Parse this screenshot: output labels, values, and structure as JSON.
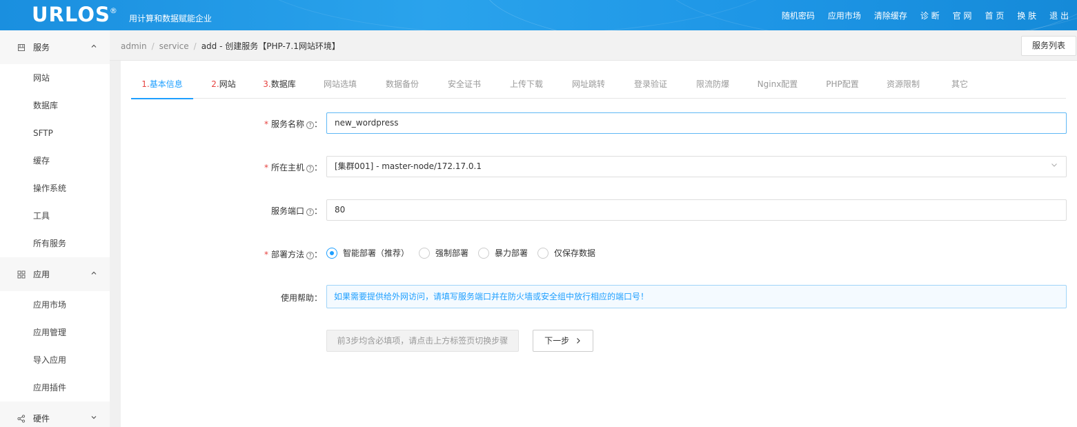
{
  "header": {
    "logo": "URLOS",
    "logo_mark": "®",
    "slogan": "用计算和数据赋能企业",
    "nav": [
      "随机密码",
      "应用市场",
      "清除缓存",
      "诊 断",
      "官 网",
      "首 页",
      "换 肤",
      "退 出"
    ]
  },
  "sidebar": {
    "groups": [
      {
        "label": "服务",
        "icon": "server-icon",
        "expanded": true,
        "items": [
          "网站",
          "数据库",
          "SFTP",
          "缓存",
          "操作系统",
          "工具",
          "所有服务"
        ]
      },
      {
        "label": "应用",
        "icon": "grid-icon",
        "expanded": true,
        "items": [
          "应用市场",
          "应用管理",
          "导入应用",
          "应用插件"
        ]
      },
      {
        "label": "硬件",
        "icon": "share-nodes-icon",
        "expanded": false,
        "items": []
      }
    ]
  },
  "breadcrumb": {
    "items": [
      "admin",
      "service"
    ],
    "current": "add - 创建服务【PHP-7.1网站环境】",
    "list_button": "服务列表"
  },
  "tabs": [
    {
      "num": "1.",
      "label": "基本信息",
      "state": "active"
    },
    {
      "num": "2.",
      "label": "网站",
      "state": "required"
    },
    {
      "num": "3.",
      "label": "数据库",
      "state": "required"
    },
    {
      "num": "",
      "label": "网站选填",
      "state": "normal"
    },
    {
      "num": "",
      "label": "数据备份",
      "state": "normal"
    },
    {
      "num": "",
      "label": "安全证书",
      "state": "normal"
    },
    {
      "num": "",
      "label": "上传下载",
      "state": "normal"
    },
    {
      "num": "",
      "label": "网址跳转",
      "state": "normal"
    },
    {
      "num": "",
      "label": "登录验证",
      "state": "normal"
    },
    {
      "num": "",
      "label": "限流防爆",
      "state": "normal"
    },
    {
      "num": "",
      "label": "Nginx配置",
      "state": "normal"
    },
    {
      "num": "",
      "label": "PHP配置",
      "state": "normal"
    },
    {
      "num": "",
      "label": "资源限制",
      "state": "normal"
    },
    {
      "num": "",
      "label": "其它",
      "state": "normal"
    }
  ],
  "form": {
    "required_mark": "*",
    "help_icon": "?",
    "service_name": {
      "label": "服务名称",
      "value": "new_wordpress"
    },
    "host": {
      "label": "所在主机",
      "value": "[集群001] - master-node/172.17.0.1"
    },
    "port": {
      "label": "服务端口",
      "value": "80"
    },
    "deploy": {
      "label": "部署方法",
      "options": [
        "智能部署（推荐）",
        "强制部署",
        "暴力部署",
        "仅保存数据"
      ],
      "selected": 0
    },
    "help": {
      "label": "使用帮助：",
      "text": "如果需要提供给外网访问，请填写服务端口并在防火墙或安全组中放行相应的端口号！"
    },
    "disabled_hint": "前3步均含必填项，请点击上方标签页切换步骤",
    "next_label": "下一步"
  },
  "colors": {
    "accent": "#1e9fff",
    "required": "#e64340",
    "header": "#1e96e6"
  }
}
